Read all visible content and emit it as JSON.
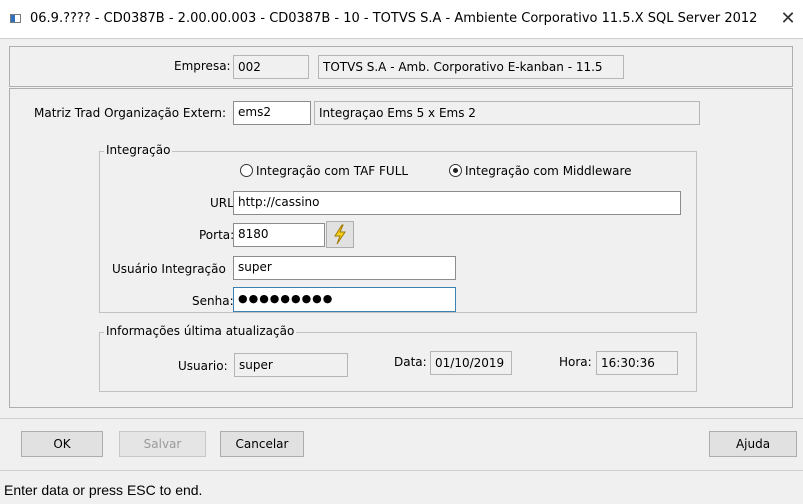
{
  "window": {
    "title": "06.9.???? - CD0387B - 2.00.00.003 - CD0387B - 10 - TOTVS S.A - Ambiente Corporativo 11.5.X SQL Server 2012",
    "close": "✕"
  },
  "header": {
    "empresa_label": "Empresa:",
    "empresa_code": "002",
    "empresa_desc": "TOTVS S.A - Amb. Corporativo E-kanban - 11.5"
  },
  "form": {
    "matriz_label": "Matriz Trad Organização Extern:",
    "matriz_value": "ems2",
    "matriz_desc": "Integraçao Ems 5 x Ems 2",
    "integracao": {
      "legend": "Integração",
      "radio_taf": "Integração com TAF FULL",
      "radio_middleware": "Integração com Middleware",
      "selected": "middleware",
      "url_label": "URL:",
      "url_value": "http://cassino",
      "porta_label": "Porta:",
      "porta_value": "8180",
      "test_icon": "lightning-bolt-icon",
      "usuario_label": "Usuário Integração",
      "usuario_value": "super",
      "senha_label": "Senha:",
      "senha_value": "●●●●●●●●●"
    },
    "ultima": {
      "legend": "Informações última atualização",
      "usuario_label": "Usuario:",
      "usuario_value": "super",
      "data_label": "Data:",
      "data_value": "01/10/2019",
      "hora_label": "Hora:",
      "hora_value": "16:30:36"
    }
  },
  "buttons": {
    "ok": "OK",
    "salvar": "Salvar",
    "cancelar": "Cancelar",
    "ajuda": "Ajuda"
  },
  "status": {
    "text": "Enter data or press ESC to end."
  }
}
